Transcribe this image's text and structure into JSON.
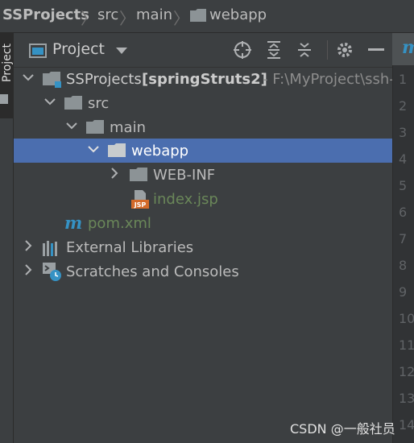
{
  "breadcrumb": {
    "project": "SSProjects",
    "items": [
      "src",
      "main",
      "webapp"
    ]
  },
  "tool_strip": {
    "label": "Project"
  },
  "panel": {
    "title": "Project",
    "toolbar_icons": [
      "locate-icon",
      "expand-all-icon",
      "collapse-all-icon",
      "gear-icon",
      "minimize-icon"
    ]
  },
  "tree": {
    "root": {
      "name": "SSProjects",
      "module": "[springStruts2]",
      "path": "- F:\\MyProject\\ssh-"
    },
    "src": "src",
    "main": "main",
    "webapp": "webapp",
    "webinf": "WEB-INF",
    "index": "index.jsp",
    "pom": "pom.xml",
    "ext_libs": "External Libraries",
    "scratches": "Scratches and Consoles"
  },
  "editor": {
    "tab_icon": "m",
    "line_numbers": [
      "1",
      "2",
      "3",
      "4",
      "5",
      "6",
      "7",
      "8",
      "9",
      "10",
      "11",
      "12",
      "13",
      "14"
    ]
  },
  "watermark": "CSDN @一般社员",
  "colors": {
    "background": "#3c3f41",
    "selection": "#4b6eaf",
    "jsp_green": "#6a8759",
    "maven_teal": "#3592c4"
  }
}
